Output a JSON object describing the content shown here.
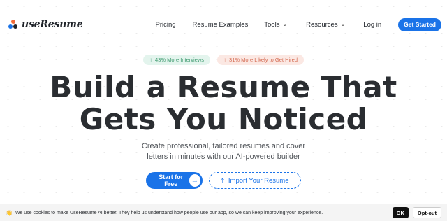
{
  "brand": {
    "name": "useResume"
  },
  "nav": {
    "pricing": "Pricing",
    "examples": "Resume Examples",
    "tools": "Tools",
    "resources": "Resources",
    "login": "Log in",
    "cta": "Get Started"
  },
  "badges": {
    "interviews": "43% More Interviews",
    "hired": "31% More Likely to Get Hired"
  },
  "hero": {
    "line1": "Build a Resume That",
    "line2": "Gets You Noticed",
    "subtitle_line1": "Create professional, tailored resumes and cover",
    "subtitle_line2": "letters in minutes with our AI-powered builder",
    "start_label": "Start for Free",
    "import_label": "Import Your Resume"
  },
  "cookie": {
    "text": "We use cookies to make UseResume AI better. They help us understand how people use our app, so we can keep improving your experience.",
    "ok": "OK",
    "opt_out": "Opt-out"
  },
  "icons": {
    "chevron": "chevron-down-icon",
    "arrow_up": "arrow-up-icon",
    "arrow_right": "arrow-right-icon",
    "upload": "upload-icon",
    "wave": "waving-hand-icon"
  },
  "colors": {
    "primary": "#1a73e8",
    "badge_green_bg": "#e3f4ed",
    "badge_green_text": "#3e9a6f",
    "badge_red_bg": "#fbe8e3",
    "badge_red_text": "#d46b52",
    "headline": "#2a2d31"
  }
}
